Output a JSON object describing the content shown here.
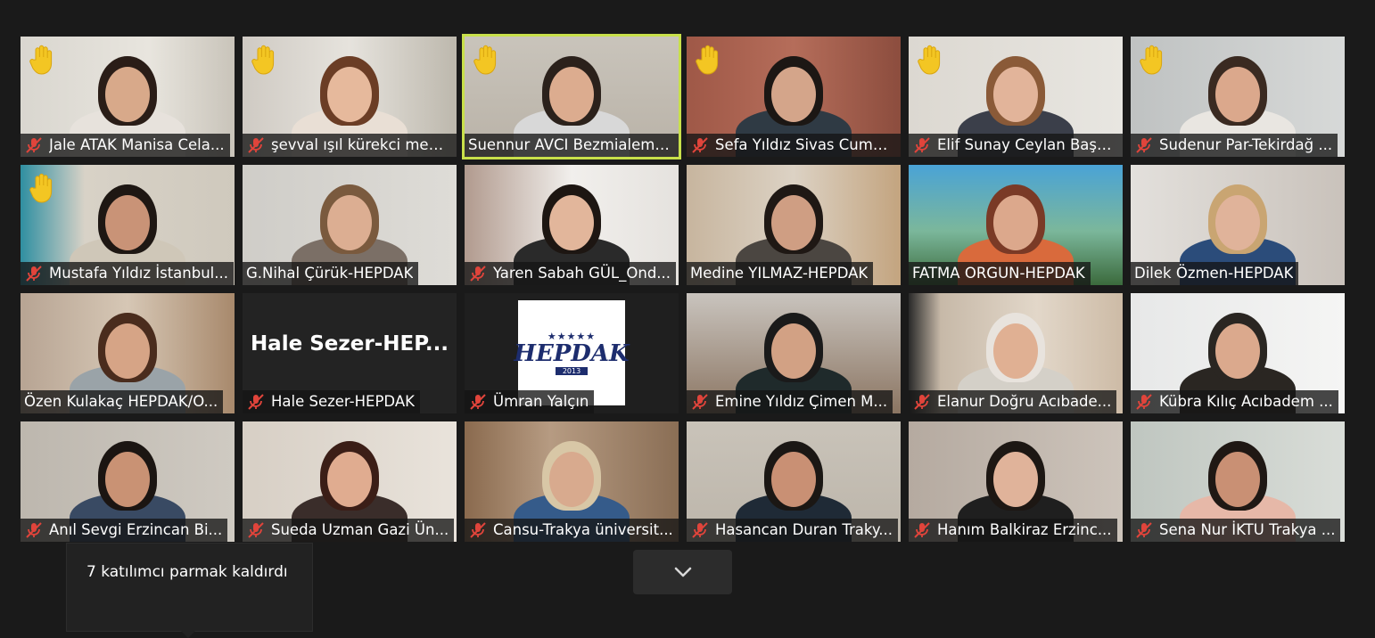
{
  "participants": [
    {
      "name": "Jale ATAK Manisa Cela...",
      "hand_raised": true,
      "muted": true
    },
    {
      "name": "şevval ışıl kürekci medi...",
      "hand_raised": true,
      "muted": true
    },
    {
      "name": "Suennur AVCI Bezmialem ...",
      "hand_raised": true,
      "muted": false,
      "active_speaker": true
    },
    {
      "name": "Sefa Yıldız Sivas Cumh...",
      "hand_raised": true,
      "muted": true
    },
    {
      "name": "Elif Sunay Ceylan Başk...",
      "hand_raised": true,
      "muted": true
    },
    {
      "name": "Sudenur Par-Tekirdağ ...",
      "hand_raised": true,
      "muted": true
    },
    {
      "name": "Mustafa Yıldız İstanbul...",
      "hand_raised": true,
      "muted": true
    },
    {
      "name": "G.Nihal Çürük-HEPDAK",
      "hand_raised": false,
      "muted": false
    },
    {
      "name": "Yaren Sabah GÜL_Ond...",
      "hand_raised": false,
      "muted": true
    },
    {
      "name": "Medine YILMAZ-HEPDAK",
      "hand_raised": false,
      "muted": false
    },
    {
      "name": "FATMA ORGUN-HEPDAK",
      "hand_raised": false,
      "muted": false
    },
    {
      "name": "Dilek Özmen-HEPDAK",
      "hand_raised": false,
      "muted": false
    },
    {
      "name": "Özen Kulakaç HEPDAK/O...",
      "hand_raised": false,
      "muted": false
    },
    {
      "name": "Hale Sezer-HEPDAK",
      "hand_raised": false,
      "muted": true,
      "video_off": true,
      "display_name": "Hale  Sezer-HEP..."
    },
    {
      "name": "Ümran Yalçın",
      "hand_raised": false,
      "muted": true,
      "logo": {
        "word": "HEPDAK",
        "year": "2013",
        "stars": "★★★★★"
      }
    },
    {
      "name": "Emine Yıldız Çimen M...",
      "hand_raised": false,
      "muted": true
    },
    {
      "name": "Elanur Doğru Acıbade...",
      "hand_raised": false,
      "muted": true
    },
    {
      "name": "Kübra Kılıç Acıbadem ...",
      "hand_raised": false,
      "muted": true
    },
    {
      "name": "Anıl Sevgi Erzincan Bi...",
      "hand_raised": false,
      "muted": true
    },
    {
      "name": "Sueda Uzman Gazi Ün...",
      "hand_raised": false,
      "muted": true
    },
    {
      "name": "Cansu-Trakya üniversit...",
      "hand_raised": false,
      "muted": true
    },
    {
      "name": "Hasancan Duran Traky...",
      "hand_raised": false,
      "muted": true
    },
    {
      "name": "Hanım Balkiraz Erzinc...",
      "hand_raised": false,
      "muted": true
    },
    {
      "name": "Sena Nur İKTU Trakya ...",
      "hand_raised": false,
      "muted": true
    }
  ],
  "tooltip": {
    "text": "7 katılımcı parmak kaldırdı"
  },
  "icons": {
    "hand": "raised-hand-icon",
    "mic": "muted-mic-icon",
    "expand": "chevron-down-icon"
  },
  "colors": {
    "background": "#1a1a1a",
    "active_border": "#c8e04a",
    "hand": "#f3c623",
    "muted_mic": "#e0443b"
  }
}
